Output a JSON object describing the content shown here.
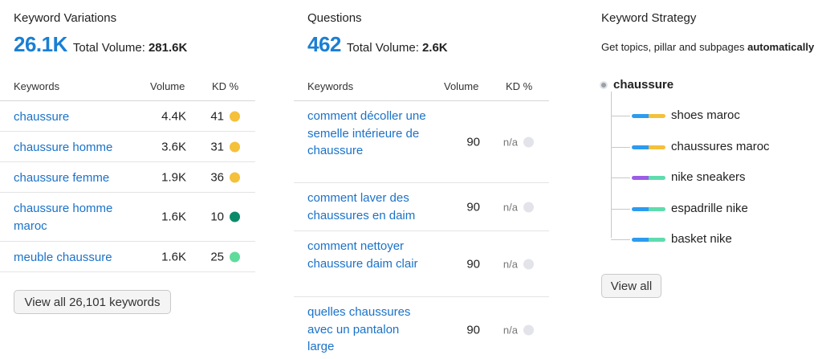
{
  "keyword_variations": {
    "title": "Keyword Variations",
    "count": "26.1K",
    "total_volume_label": "Total Volume:",
    "total_volume": "281.6K",
    "headers": {
      "keywords": "Keywords",
      "volume": "Volume",
      "kd": "KD %"
    },
    "rows": [
      {
        "keyword": "chaussure",
        "volume": "4.4K",
        "kd": "41",
        "kd_color": "#f5c03a"
      },
      {
        "keyword": "chaussure homme",
        "volume": "3.6K",
        "kd": "31",
        "kd_color": "#f5c03a"
      },
      {
        "keyword": "chaussure femme",
        "volume": "1.9K",
        "kd": "36",
        "kd_color": "#f5c03a"
      },
      {
        "keyword": "chaussure homme maroc",
        "volume": "1.6K",
        "kd": "10",
        "kd_color": "#0b8a6a"
      },
      {
        "keyword": "meuble chaussure",
        "volume": "1.6K",
        "kd": "25",
        "kd_color": "#5fdc9c"
      }
    ],
    "view_all_label": "View all 26,101 keywords"
  },
  "questions": {
    "title": "Questions",
    "count": "462",
    "total_volume_label": "Total Volume:",
    "total_volume": "2.6K",
    "headers": {
      "keywords": "Keywords",
      "volume": "Volume",
      "kd": "KD %"
    },
    "rows": [
      {
        "keyword": "comment décoller une semelle intérieure de chaussure",
        "volume": "90",
        "kd": "n/a"
      },
      {
        "keyword": "comment laver des chaussures en daim",
        "volume": "90",
        "kd": "n/a"
      },
      {
        "keyword": "comment nettoyer chaussure daim clair",
        "volume": "90",
        "kd": "n/a"
      },
      {
        "keyword": "quelles chaussures avec un pantalon large",
        "volume": "90",
        "kd": "n/a"
      }
    ],
    "na_dot_color": "#e3e3ea"
  },
  "keyword_strategy": {
    "title": "Keyword Strategy",
    "subtitle_prefix": "Get topics, pillar and subpages ",
    "subtitle_bold": "automatically",
    "root": "chaussure",
    "children": [
      {
        "label": "shoes maroc",
        "colors": [
          "#2c9bf0",
          "#f5c03a"
        ]
      },
      {
        "label": "chaussures maroc",
        "colors": [
          "#2c9bf0",
          "#f5c03a"
        ]
      },
      {
        "label": "nike sneakers",
        "colors": [
          "#9b5de5",
          "#5fdcae"
        ]
      },
      {
        "label": "espadrille nike",
        "colors": [
          "#2c9bf0",
          "#5fdcae"
        ]
      },
      {
        "label": "basket nike",
        "colors": [
          "#2c9bf0",
          "#5fdcae"
        ]
      }
    ],
    "view_all_label": "View all"
  }
}
